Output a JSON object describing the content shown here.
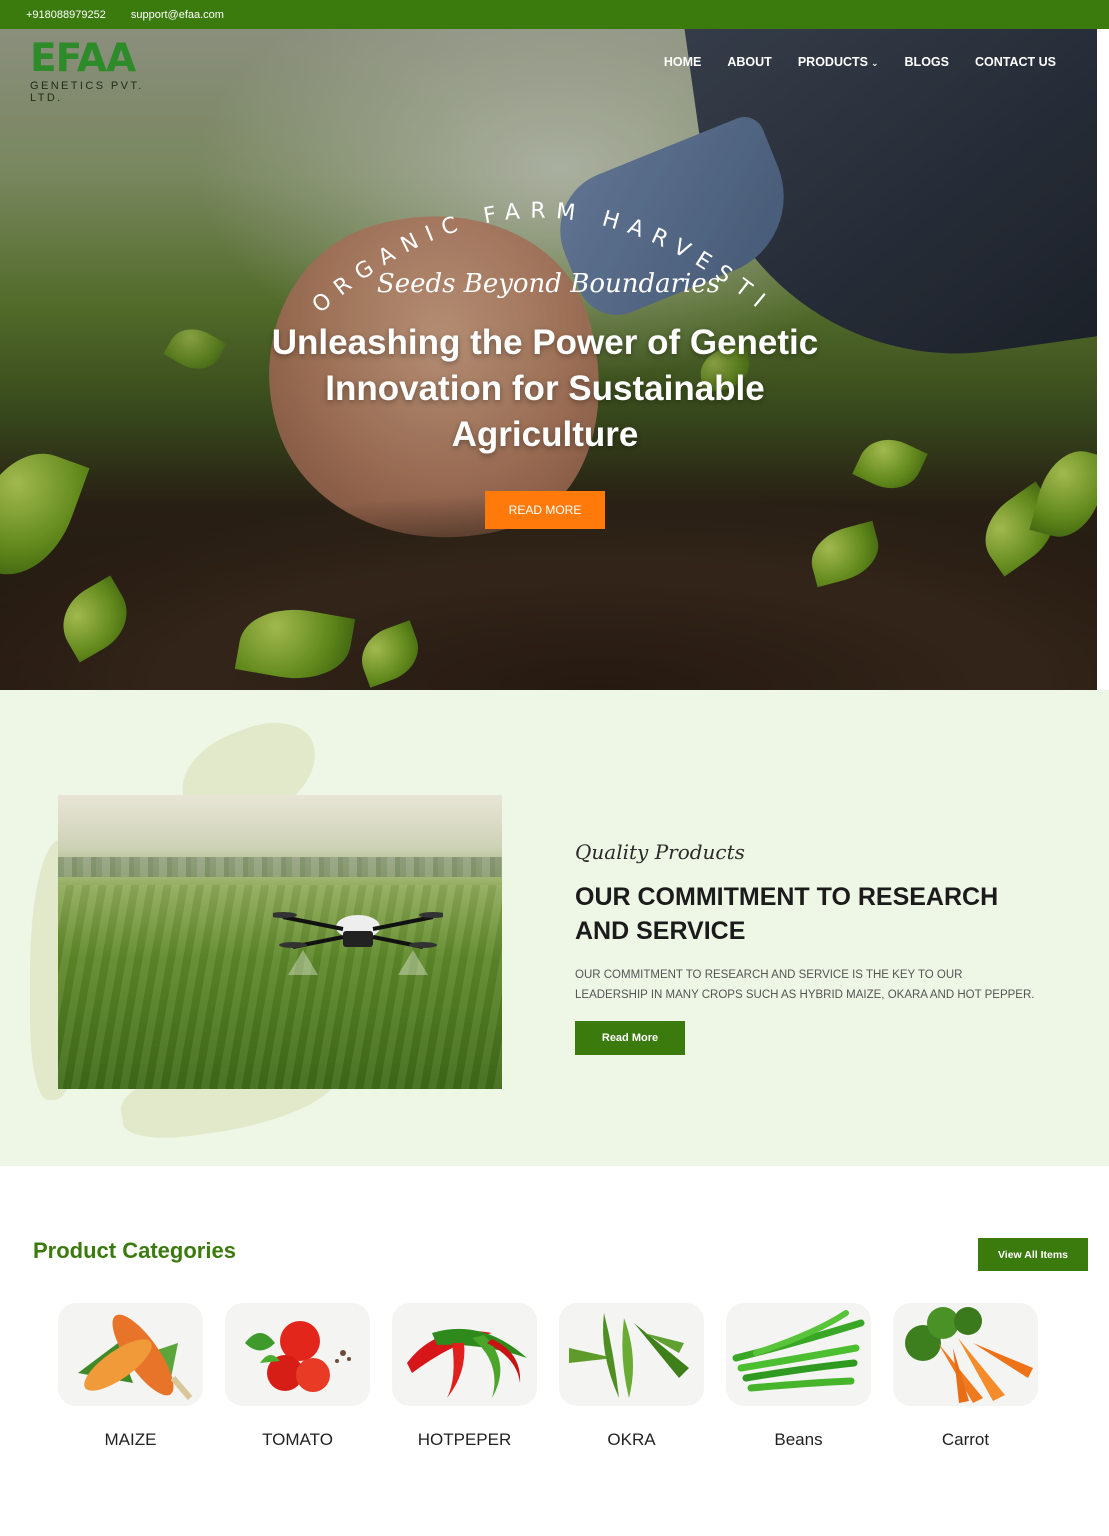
{
  "topbar": {
    "phone": "+918088979252",
    "email": "support@efaa.com"
  },
  "brand": {
    "name": "EFAA",
    "subtitle": "GENETICS PVT. LTD."
  },
  "nav": {
    "items": [
      "HOME",
      "ABOUT",
      "PRODUCTS",
      "BLOGS",
      "CONTACT US"
    ]
  },
  "hero": {
    "arc_text": "ORGANIC FARM HARVESTING",
    "tagline": "Seeds Beyond Boundaries",
    "headline": "Unleashing the Power of Genetic Innovation for Sustainable Agriculture",
    "cta": "READ MORE"
  },
  "commitment": {
    "script": "Quality Products",
    "title": "OUR COMMITMENT TO RESEARCH AND SERVICE",
    "body": "OUR COMMITMENT TO RESEARCH AND SERVICE IS THE KEY TO OUR LEADERSHIP IN MANY CROPS SUCH AS HYBRID MAIZE, OKARA AND HOT PEPPER.",
    "button": "Read More"
  },
  "categories": {
    "title": "Product Categories",
    "view_all": "View All Items",
    "items": [
      {
        "label": "MAIZE",
        "icon": "corn-icon"
      },
      {
        "label": "TOMATO",
        "icon": "tomato-icon"
      },
      {
        "label": "HOTPEPER",
        "icon": "chili-icon"
      },
      {
        "label": "OKRA",
        "icon": "okra-icon"
      },
      {
        "label": "Beans",
        "icon": "beans-icon"
      },
      {
        "label": "Carrot",
        "icon": "carrot-icon"
      }
    ]
  },
  "colors": {
    "brand_green": "#3b7a0d",
    "accent_orange": "#ff7a0a",
    "section_bg": "#eef7e6"
  }
}
